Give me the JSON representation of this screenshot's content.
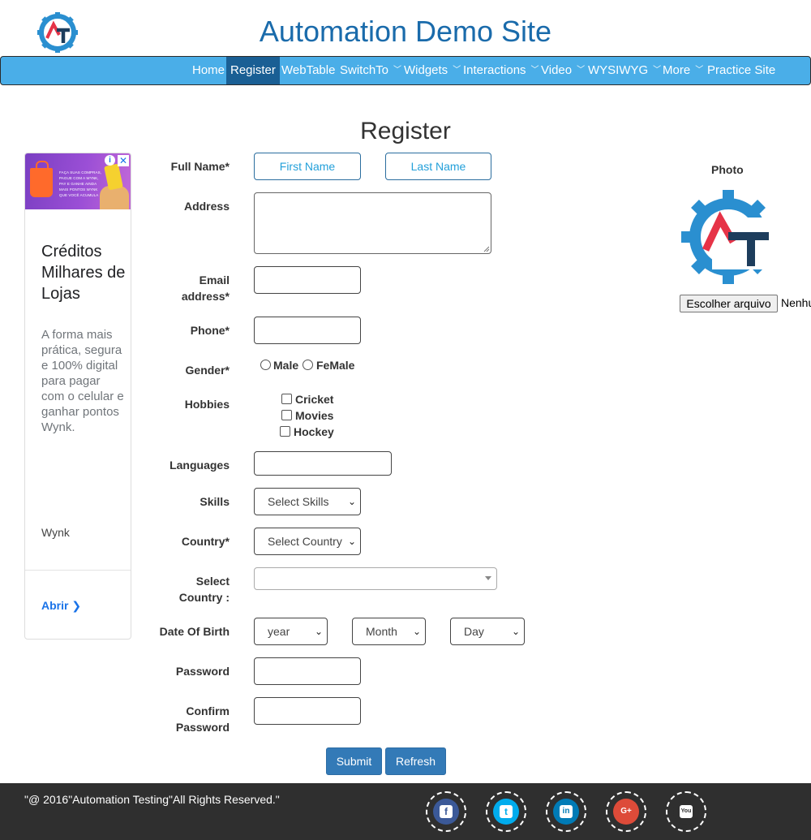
{
  "header": {
    "title": "Automation Demo Site"
  },
  "nav": {
    "items": [
      {
        "label": "Home"
      },
      {
        "label": "Register"
      },
      {
        "label": "WebTable"
      },
      {
        "label": "SwitchTo"
      },
      {
        "label": "Widgets"
      },
      {
        "label": "Interactions"
      },
      {
        "label": "Video"
      },
      {
        "label": "WYSIWYG"
      },
      {
        "label": "More"
      },
      {
        "label": "Practice Site"
      }
    ],
    "active": "Register"
  },
  "page": {
    "heading": "Register"
  },
  "ad": {
    "banner_text": "FAÇA SUAS COMPRAS, PAGUE COM A WYNK, PAY E GANHE AINDA MAIS PONTOS WYNK QUE VOCÊ ACUMULA",
    "headline": "Créditos Milhares de Lojas",
    "body": "A forma mais prática, segura e 100% digital para pagar com o celular e ganhar pontos Wynk.",
    "brand": "Wynk",
    "cta": "Abrir",
    "info_glyph": "i",
    "close_glyph": "✕"
  },
  "form": {
    "full_name_label": "Full Name*",
    "first_name_placeholder": "First Name",
    "last_name_placeholder": "Last Name",
    "address_label": "Address",
    "email_label_line1": "Email",
    "email_label_line2": "address*",
    "phone_label": "Phone*",
    "gender_label": "Gender*",
    "gender_male": "Male",
    "gender_female": "FeMale",
    "hobbies_label": "Hobbies",
    "hobby_cricket": "Cricket",
    "hobby_movies": "Movies",
    "hobby_hockey": "Hockey",
    "languages_label": "Languages",
    "skills_label": "Skills",
    "skills_value": "Select Skills",
    "country_label": "Country*",
    "country_value": "Select Country",
    "select_country_line1": "Select",
    "select_country_line2": "Country :",
    "dob_label": "Date Of Birth",
    "year_value": "year",
    "month_value": "Month",
    "day_value": "Day",
    "password_label": "Password",
    "confirm_line1": "Confirm",
    "confirm_line2": "Password",
    "submit_label": "Submit",
    "refresh_label": "Refresh"
  },
  "photo": {
    "label": "Photo",
    "file_button": "Escolher arquivo",
    "file_status": "Nenhum arquivo escolhido"
  },
  "footer": {
    "copyright": "\"@ 2016\"Automation Testing\"All Rights Reserved.\"",
    "social": [
      {
        "name": "facebook",
        "glyph": "f",
        "color": "#3b5998"
      },
      {
        "name": "twitter",
        "glyph": "t",
        "color": "#00aced"
      },
      {
        "name": "linkedin",
        "glyph": "in",
        "color": "#007bb6"
      },
      {
        "name": "google-plus",
        "glyph": "G+",
        "color": "#dd4b39"
      },
      {
        "name": "youtube",
        "glyph": "You",
        "color": "#2f2f2f"
      }
    ]
  },
  "colors": {
    "brand_blue": "#1a6bab",
    "nav_bg": "#4aaee8",
    "nav_active": "#1a5f94",
    "button": "#337ab7"
  }
}
